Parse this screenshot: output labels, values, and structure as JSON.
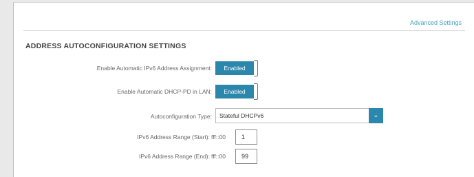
{
  "header": {
    "advanced_link": "Advanced Settings"
  },
  "section": {
    "title": "ADDRESS AUTOCONFIGURATION SETTINGS"
  },
  "fields": {
    "auto_ipv6": {
      "label": "Enable Automatic IPv6 Address Assignment:",
      "value": "Enabled"
    },
    "auto_dhcp_pd": {
      "label": "Enable Automatic DHCP-PD in LAN:",
      "value": "Enabled"
    },
    "autoconf_type": {
      "label": "Autoconfiguration Type:",
      "value": "Stateful DHCPv6"
    },
    "range_start": {
      "label": "IPv6 Address Range (Start):",
      "prefix": "fff::00",
      "value": "1"
    },
    "range_end": {
      "label": "IPv6 Address Range (End):",
      "prefix": "fff::00",
      "value": "99"
    }
  },
  "icons": {
    "dropdown": "chevron-down-icon"
  },
  "colors": {
    "accent": "#2b87ac",
    "link": "#4aa1c4"
  }
}
